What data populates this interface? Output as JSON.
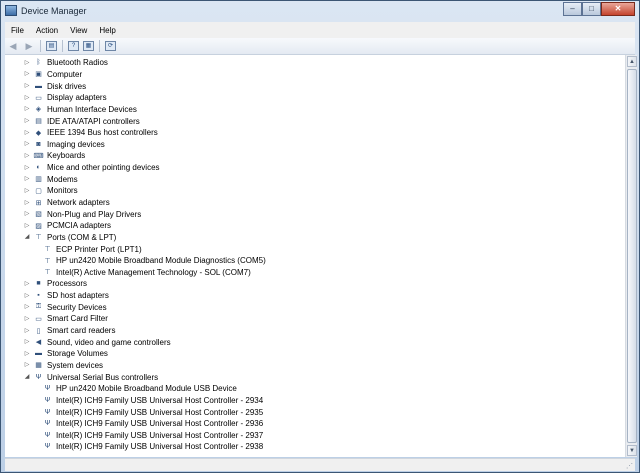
{
  "window": {
    "title": "Device Manager",
    "controls": {
      "minimize": "–",
      "maximize": "□",
      "close": "✕"
    }
  },
  "menu": [
    "File",
    "Action",
    "View",
    "Help"
  ],
  "toolbar": {
    "icons": [
      "back-arrow-icon",
      "forward-arrow-icon",
      "show-hide-console-tree-icon",
      "help-icon",
      "properties-icon",
      "scan-hardware-icon"
    ]
  },
  "tree": [
    {
      "level": 0,
      "expander": "collapsed",
      "icon": "bluetooth-icon",
      "label": "Bluetooth Radios"
    },
    {
      "level": 0,
      "expander": "collapsed",
      "icon": "computer-icon",
      "label": "Computer"
    },
    {
      "level": 0,
      "expander": "collapsed",
      "icon": "disk-drive-icon",
      "label": "Disk drives"
    },
    {
      "level": 0,
      "expander": "collapsed",
      "icon": "display-adapter-icon",
      "label": "Display adapters"
    },
    {
      "level": 0,
      "expander": "collapsed",
      "icon": "hid-icon",
      "label": "Human Interface Devices"
    },
    {
      "level": 0,
      "expander": "collapsed",
      "icon": "ide-controller-icon",
      "label": "IDE ATA/ATAPI controllers"
    },
    {
      "level": 0,
      "expander": "collapsed",
      "icon": "firewire-icon",
      "label": "IEEE 1394 Bus host controllers"
    },
    {
      "level": 0,
      "expander": "collapsed",
      "icon": "imaging-device-icon",
      "label": "Imaging devices"
    },
    {
      "level": 0,
      "expander": "collapsed",
      "icon": "keyboard-icon",
      "label": "Keyboards"
    },
    {
      "level": 0,
      "expander": "collapsed",
      "icon": "mouse-icon",
      "label": "Mice and other pointing devices"
    },
    {
      "level": 0,
      "expander": "collapsed",
      "icon": "modem-icon",
      "label": "Modems"
    },
    {
      "level": 0,
      "expander": "collapsed",
      "icon": "monitor-icon",
      "label": "Monitors"
    },
    {
      "level": 0,
      "expander": "collapsed",
      "icon": "network-adapter-icon",
      "label": "Network adapters"
    },
    {
      "level": 0,
      "expander": "collapsed",
      "icon": "non-pnp-driver-icon",
      "label": "Non-Plug and Play Drivers"
    },
    {
      "level": 0,
      "expander": "collapsed",
      "icon": "pcmcia-icon",
      "label": "PCMCIA adapters"
    },
    {
      "level": 0,
      "expander": "expanded",
      "icon": "port-icon",
      "label": "Ports (COM & LPT)"
    },
    {
      "level": 1,
      "expander": "none",
      "icon": "port-icon",
      "label": "ECP Printer Port (LPT1)"
    },
    {
      "level": 1,
      "expander": "none",
      "icon": "port-icon",
      "label": "HP un2420 Mobile Broadband Module Diagnostics (COM5)"
    },
    {
      "level": 1,
      "expander": "none",
      "icon": "port-icon",
      "label": "Intel(R) Active Management Technology - SOL (COM7)"
    },
    {
      "level": 0,
      "expander": "collapsed",
      "icon": "processor-icon",
      "label": "Processors"
    },
    {
      "level": 0,
      "expander": "collapsed",
      "icon": "sd-host-icon",
      "label": "SD host adapters"
    },
    {
      "level": 0,
      "expander": "collapsed",
      "icon": "security-key-icon",
      "label": "Security Devices"
    },
    {
      "level": 0,
      "expander": "collapsed",
      "icon": "smart-card-icon",
      "label": "Smart Card Filter"
    },
    {
      "level": 0,
      "expander": "collapsed",
      "icon": "smart-card-reader-icon",
      "label": "Smart card readers"
    },
    {
      "level": 0,
      "expander": "collapsed",
      "icon": "speaker-icon",
      "label": "Sound, video and game controllers"
    },
    {
      "level": 0,
      "expander": "collapsed",
      "icon": "storage-volume-icon",
      "label": "Storage Volumes"
    },
    {
      "level": 0,
      "expander": "collapsed",
      "icon": "system-device-icon",
      "label": "System devices"
    },
    {
      "level": 0,
      "expander": "expanded",
      "icon": "usb-icon",
      "label": "Universal Serial Bus controllers"
    },
    {
      "level": 1,
      "expander": "none",
      "icon": "usb-icon",
      "label": "HP un2420 Mobile Broadband Module USB Device"
    },
    {
      "level": 1,
      "expander": "none",
      "icon": "usb-icon",
      "label": "Intel(R) ICH9 Family USB Universal Host Controller - 2934"
    },
    {
      "level": 1,
      "expander": "none",
      "icon": "usb-icon",
      "label": "Intel(R) ICH9 Family USB Universal Host Controller - 2935"
    },
    {
      "level": 1,
      "expander": "none",
      "icon": "usb-icon",
      "label": "Intel(R) ICH9 Family USB Universal Host Controller - 2936"
    },
    {
      "level": 1,
      "expander": "none",
      "icon": "usb-icon",
      "label": "Intel(R) ICH9 Family USB Universal Host Controller - 2937"
    },
    {
      "level": 1,
      "expander": "none",
      "icon": "usb-icon",
      "label": "Intel(R) ICH9 Family USB Universal Host Controller - 2938"
    }
  ]
}
